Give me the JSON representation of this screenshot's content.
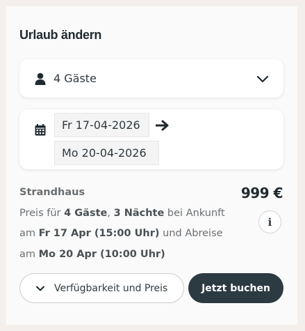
{
  "panel": {
    "title": "Urlaub ändern"
  },
  "guests": {
    "label": "4 Gäste",
    "icon": "person-icon",
    "toggle_icon": "chevron-down-icon"
  },
  "dates": {
    "icon": "calendar-icon",
    "arrival": "Fr 17-04-2026",
    "departure": "Mo 20-04-2026",
    "arrow_icon": "arrow-right-icon"
  },
  "summary": {
    "property_name": "Strandhaus",
    "price": "999 €",
    "text_1": "Preis für ",
    "guests_bold": "4 Gäste",
    "comma": ", ",
    "nights_bold": "3 Nächte",
    "text_2": " bei Ankunft am ",
    "arrival_bold": "Fr 17 Apr (15:00 Uhr)",
    "text_3": " und Abreise am ",
    "departure_bold": "Mo 20 Apr (10:00 Uhr)",
    "info_label": "i"
  },
  "actions": {
    "availability_label": "Verfügbarkeit und Preis",
    "book_label": "Jetzt buchen"
  },
  "colors": {
    "primary_dark": "#2c3a41",
    "background": "#f4efec"
  }
}
